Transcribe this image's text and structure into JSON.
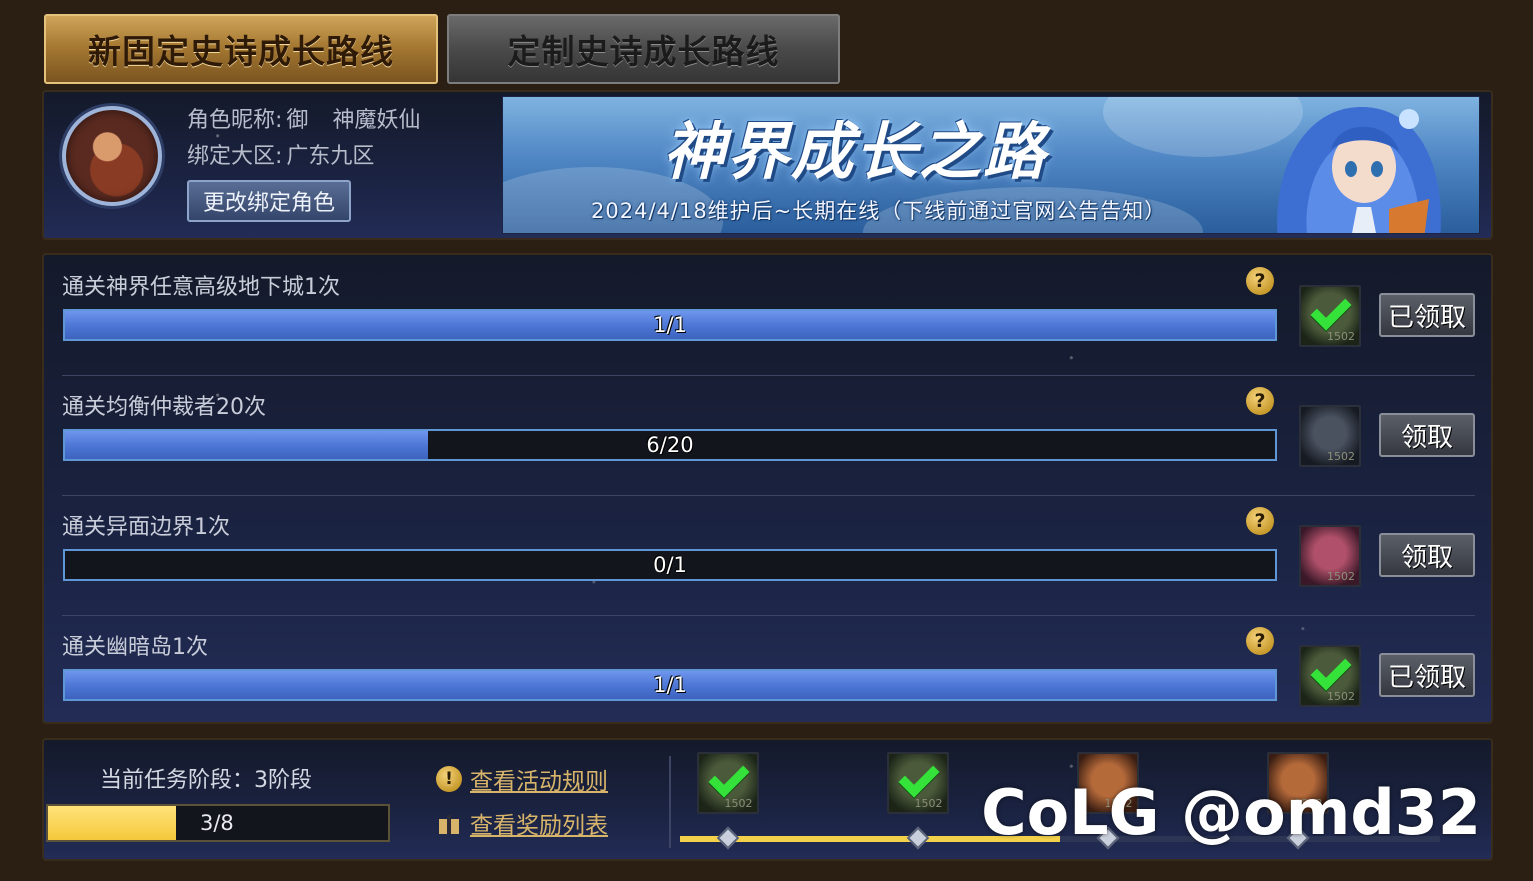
{
  "tabs": [
    {
      "label": "新固定史诗成长路线",
      "active": true
    },
    {
      "label": "定制史诗成长路线",
      "active": false
    }
  ],
  "profile": {
    "nickname_label": "角色昵称:",
    "nickname_value_a": "御",
    "nickname_value_b": "神魔妖仙",
    "region_label": "绑定大区:",
    "region_value": "广东九区",
    "change_button": "更改绑定角色"
  },
  "banner": {
    "title": "神界成长之路",
    "subtitle": "2024/4/18维护后~长期在线（下线前通过官网公告告知）"
  },
  "tasks": [
    {
      "label": "通关神界任意高级地下城1次",
      "progress_text": "1/1",
      "progress": 1.0,
      "reward_state": "claimed",
      "button": "已领取",
      "help": "?",
      "reward_icon": "epic-box-icon",
      "reward_stack": "1502"
    },
    {
      "label": "通关均衡仲裁者20次",
      "progress_text": "6/20",
      "progress": 0.3,
      "reward_state": "pending",
      "button": "领取",
      "help": "?",
      "reward_icon": "epic-box-icon",
      "reward_stack": "1502"
    },
    {
      "label": "通关异面边界1次",
      "progress_text": "0/1",
      "progress": 0.0,
      "reward_state": "pending",
      "button": "领取",
      "help": "?",
      "reward_icon": "epic-box-icon",
      "reward_stack": "1502"
    },
    {
      "label": "通关幽暗岛1次",
      "progress_text": "1/1",
      "progress": 1.0,
      "reward_state": "claimed",
      "button": "已领取",
      "help": "?",
      "reward_icon": "epic-box-icon",
      "reward_stack": "1502"
    }
  ],
  "stage": {
    "label": "当前任务阶段：3阶段",
    "progress_text": "3/8",
    "progress": 0.375,
    "rules_link": "查看活动规则",
    "rewards_link": "查看奖励列表",
    "track_progress": 0.5,
    "rewards": [
      {
        "state": "claimed",
        "stack": "1502"
      },
      {
        "state": "claimed",
        "stack": "1502"
      },
      {
        "state": "locked",
        "stack": "1502"
      },
      {
        "state": "locked",
        "stack": "1502"
      }
    ]
  },
  "watermark": "CoLG @omd32",
  "colors": {
    "accent_gold": "#d7b46a",
    "progress_blue": "#4c75d4",
    "stage_yellow": "#f4c83a",
    "check_green": "#34e23a"
  }
}
